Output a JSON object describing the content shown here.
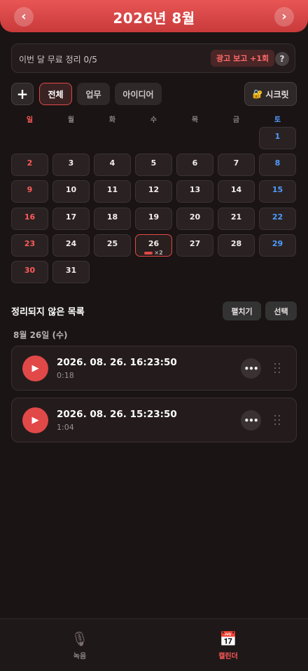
{
  "header": {
    "title": "2026년 8월",
    "prev_label": "‹",
    "next_label": "›"
  },
  "quota": {
    "text": "이번 달 무료 정리 0/5",
    "ad_button": "광고 보고 +1회",
    "help_label": "?"
  },
  "filters": {
    "add_label": "+",
    "chips": [
      "전체",
      "업무",
      "아이디어"
    ],
    "selected": "전체",
    "secret_icon": "🔐",
    "secret_label": "시크릿"
  },
  "calendar": {
    "weekdays": [
      "일",
      "월",
      "화",
      "수",
      "목",
      "금",
      "토"
    ],
    "days": [
      "1",
      "2",
      "3",
      "4",
      "5",
      "6",
      "7",
      "8",
      "9",
      "10",
      "11",
      "12",
      "13",
      "14",
      "15",
      "16",
      "17",
      "18",
      "19",
      "20",
      "21",
      "22",
      "23",
      "24",
      "25",
      "26",
      "27",
      "28",
      "29",
      "30",
      "31"
    ],
    "selected_day": "26",
    "selected_day_count": "×2"
  },
  "list": {
    "title": "정리되지 않은 목록",
    "expand_label": "펼치기",
    "select_label": "선택",
    "date_group": "8월 26일 (수)",
    "items": [
      {
        "title": "2026. 08. 26. 16:23:50",
        "duration": "0:18"
      },
      {
        "title": "2026. 08. 26. 15:23:50",
        "duration": "1:04"
      }
    ]
  },
  "bottom_nav": {
    "tabs": [
      {
        "label": "녹음",
        "icon": "🎙"
      },
      {
        "label": "캘린더",
        "icon": "📅"
      }
    ],
    "active": "캘린더"
  },
  "colors": {
    "accent": "#e14848",
    "sunday": "#ff5a5a",
    "saturday": "#4f9bff",
    "background": "#1a1414"
  }
}
